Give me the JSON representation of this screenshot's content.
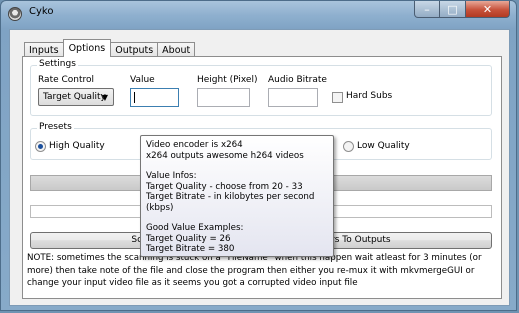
{
  "window": {
    "title": "Cyko",
    "icon": "app-icon",
    "controls": {
      "minimize": "–",
      "maximize": "□",
      "close": "✕"
    }
  },
  "tabs": [
    {
      "label": "Inputs",
      "active": false
    },
    {
      "label": "Options",
      "active": true
    },
    {
      "label": "Outputs",
      "active": false
    },
    {
      "label": "About",
      "active": false
    }
  ],
  "settings": {
    "group_label": "Settings",
    "rate_control_label": "Rate Control",
    "rate_control_value": "Target Quality",
    "value_label": "Value",
    "value_input": "",
    "height_label": "Height (Pixel)",
    "height_input": "",
    "audio_bitrate_label": "Audio Bitrate",
    "audio_bitrate_input": "",
    "hard_subs_label": "Hard Subs",
    "hard_subs_checked": false
  },
  "presets": {
    "group_label": "Presets",
    "high_quality_label": "High Quality",
    "high_quality_selected": true,
    "low_quality_label": "Low Quality",
    "low_quality_selected": false
  },
  "scan_button_label": "Scan Audio Tracks Count Then Put Parameters To Outputs",
  "note": "NOTE: sometimes the scanning is stuck on a \"FileName\" when this happen wait atleast for 3 minutes (or more) then take note of the file and close the program then either you re-mux it with mkvmergeGUI or change your input video file as it seems you got a corrupted video input file",
  "tooltip": {
    "line1": "Video encoder is x264",
    "line2": "x264 outputs awesome h264 videos",
    "line3": "Value Infos:",
    "line4": "Target Quality - choose from 20 - 33",
    "line5": "Target Bitrate - in kilobytes per second (kbps)",
    "line6": "Good Value Examples:",
    "line7": "Target Quality = 26",
    "line8": "Target Bitrate = 380"
  },
  "colors": {
    "titlebar": "#8fb0cf",
    "close_button": "#c7523b",
    "radio_dot": "#1b4f9c"
  }
}
